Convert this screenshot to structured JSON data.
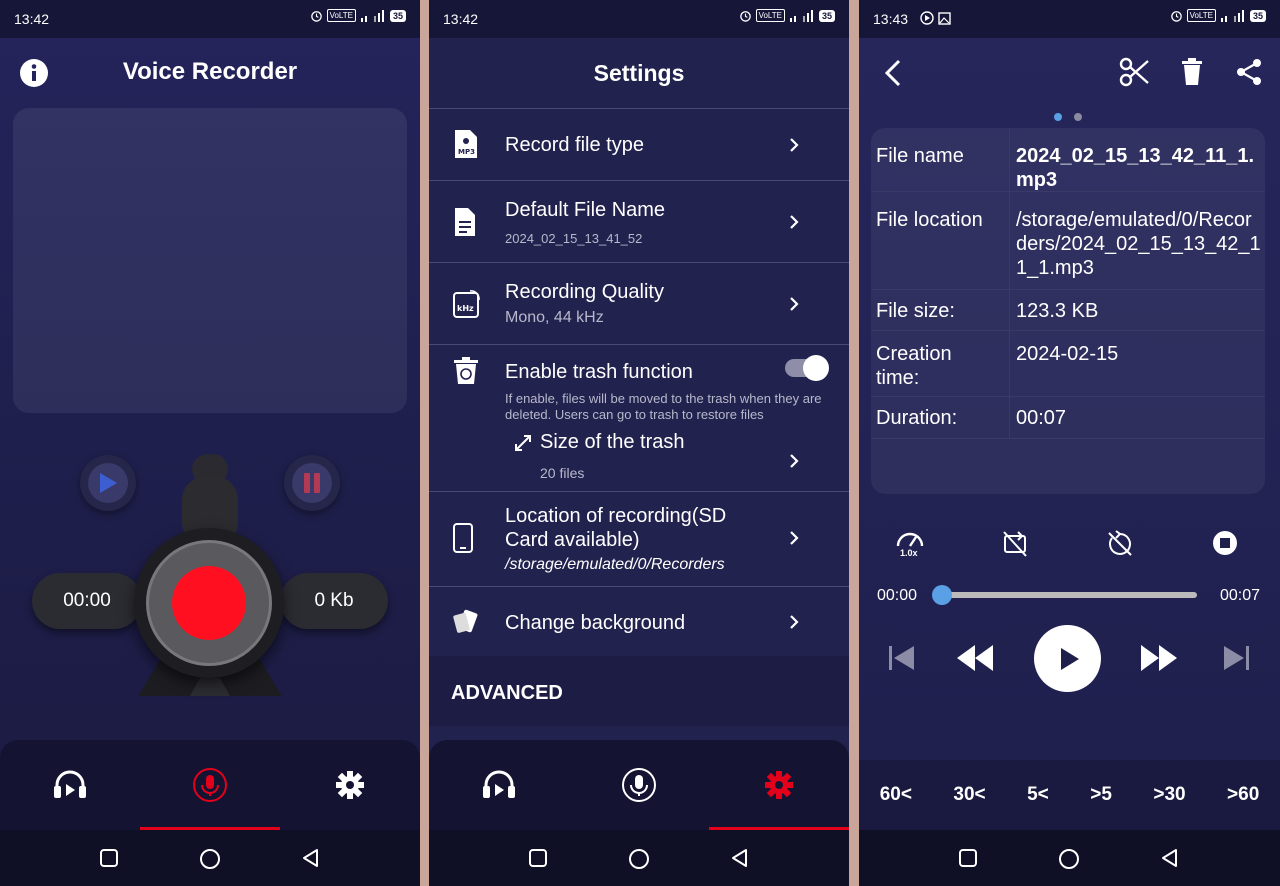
{
  "status": {
    "p1_time": "13:42",
    "p2_time": "13:42",
    "p3_time": "13:43",
    "net": "VoLTE",
    "battery": "35"
  },
  "recorder": {
    "title": "Voice Recorder",
    "elapsed": "00:00",
    "size": "0 Kb"
  },
  "settings": {
    "title": "Settings",
    "items": [
      {
        "label": "Record file type",
        "sub": ""
      },
      {
        "label": "Default File Name",
        "sub": "2024_02_15_13_41_52"
      },
      {
        "label": "Recording Quality",
        "sub": "Mono,  44 kHz"
      },
      {
        "label": "Enable trash function",
        "sub": "If enable, files will be moved to the trash when they are deleted. Users can go to trash to restore files",
        "toggle_on": true
      },
      {
        "label": "Size of the trash",
        "sub": "20 files"
      },
      {
        "label": "Location of recording(SD Card available)",
        "sub": "/storage/emulated/0/Recorders"
      },
      {
        "label": "Change background",
        "sub": ""
      }
    ],
    "advanced": "ADVANCED"
  },
  "details": {
    "rows": [
      {
        "key": "File name",
        "value": "2024_02_15_13_42_11_1.mp3"
      },
      {
        "key": "File location",
        "value": "/storage/emulated/0/Recorders/2024_02_15_13_42_11_1.mp3"
      },
      {
        "key": "File size:",
        "value": "123.3 KB"
      },
      {
        "key": "Creation time:",
        "value": "2024-02-15"
      },
      {
        "key": "Duration:",
        "value": "00:07"
      }
    ],
    "speed": "1.0x",
    "pos": "00:00",
    "dur": "00:07",
    "progress_fraction": 0.0,
    "skips": [
      "60<",
      "30<",
      "5<",
      ">5",
      ">30",
      ">60"
    ]
  },
  "colors": {
    "record_red": "#ff0f1f",
    "active_tab_red": "#e3001b",
    "accent_blue": "#5aa0e6"
  }
}
